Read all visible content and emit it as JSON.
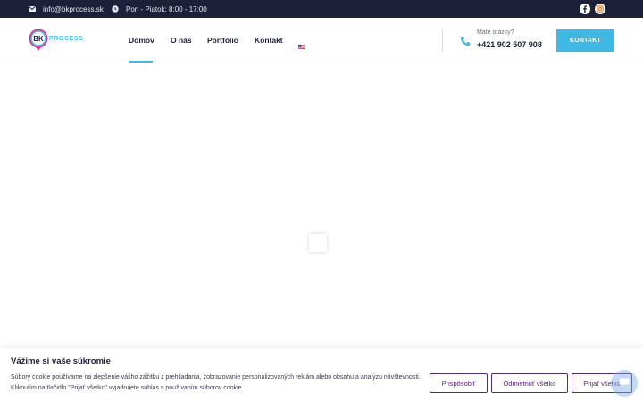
{
  "topbar": {
    "email": "info@bkprocess.sk",
    "hours": "Pon - Piatok: 8:00 - 17:00",
    "email_icon": "envelope-icon",
    "hours_icon": "clock-icon",
    "social": [
      "facebook-icon",
      "instagram-icon"
    ]
  },
  "header": {
    "logo_letters": "BK",
    "logo_text": "PROCESS",
    "nav": [
      "Domov",
      "O nás",
      "Portfólio",
      "Kontakt"
    ],
    "language_icon": "us-flag-icon",
    "phone_question": "Máte otázky?",
    "phone_number": "+421 902 507 908",
    "cta_label": "KONTAKT"
  },
  "cookie": {
    "title": "Vážime si vaše súkromie",
    "text": "Súbory cookie používame na zlepšenie vášho zážitku z prehliadania, zobrazovanie personalizovaných reklám alebo obsahu a analýzu návštevnosti. Kliknutím na tlačidlo \"Prijať všetko\" vyjadrujete súhlas s používaním súborov cookie.",
    "buttons": [
      "Prispôsobiť",
      "Odmietnuť všetko",
      "Prijať všetko"
    ]
  },
  "colors": {
    "topbar_bg": "#1c2039",
    "accent": "#3fb8e4",
    "cookie_button": "#5a2a6e",
    "logo_pink": "#e0348f"
  }
}
